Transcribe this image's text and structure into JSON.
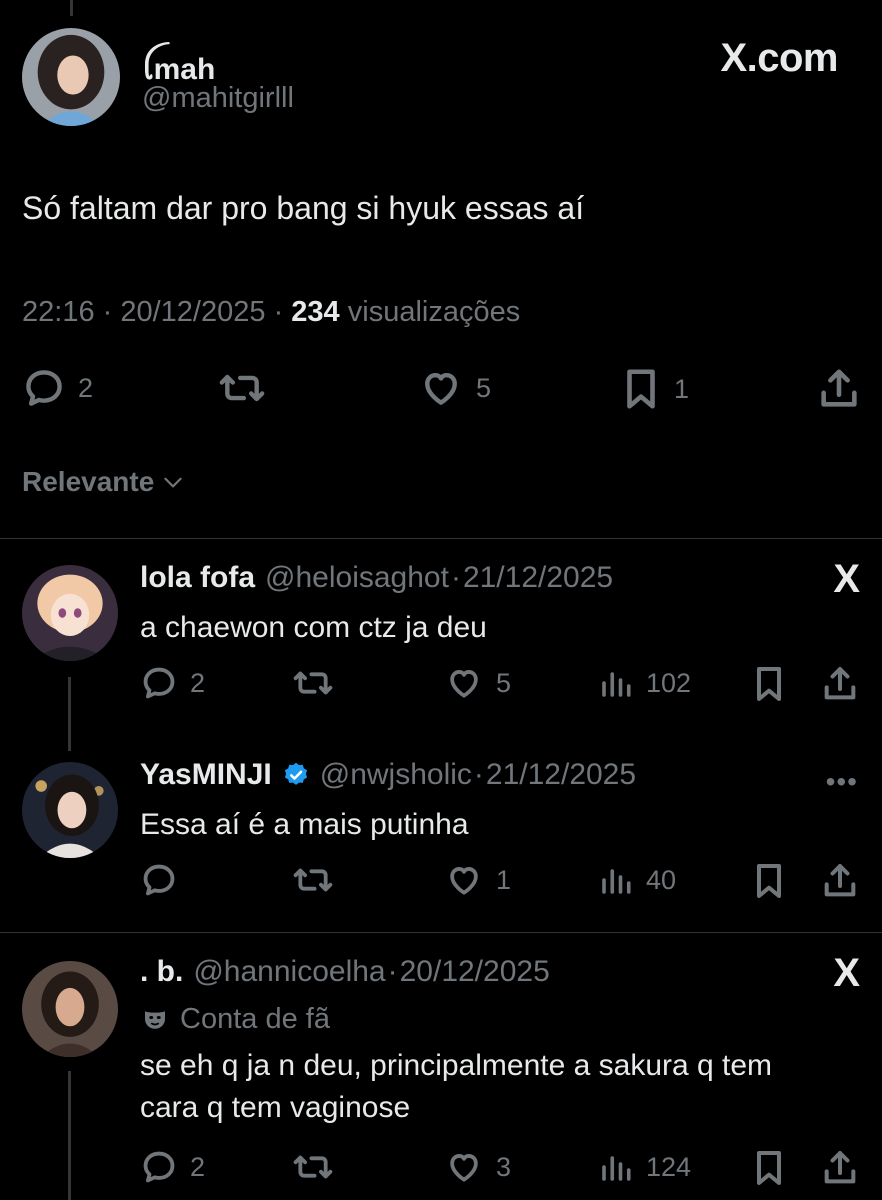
{
  "main_tweet": {
    "display_name": "ꪶmah",
    "handle": "@mahitgirlll",
    "brand": "X.com",
    "text": "Só faltam dar pro bang si hyuk essas aí",
    "time": "22:16",
    "date": "20/12/2025",
    "views_count": "234",
    "views_label": "visualizações",
    "replies": "2",
    "likes": "5",
    "bookmarks": "1"
  },
  "sort_label": "Relevante",
  "replies": [
    {
      "name": "lola fofa",
      "handle": "@heloisaghot",
      "date": "21/12/2025",
      "text": "a chaewon com ctz ja deu",
      "replies": "2",
      "likes": "5",
      "views": "102",
      "corner": "X"
    },
    {
      "name": "YasMINJI",
      "handle": "@nwjsholic",
      "date": "21/12/2025",
      "text": "Essa aí é a mais putinha",
      "replies": "",
      "likes": "1",
      "views": "40",
      "corner": "•••"
    },
    {
      "name": ". b.",
      "handle": "@hannicoelha",
      "date": "20/12/2025",
      "badge": "Conta de fã",
      "text_line1": "se eh q ja n deu, principalmente a sakura q tem",
      "text_line2": "cara q tem vaginose",
      "replies": "2",
      "likes": "3",
      "views": "124",
      "corner": "X"
    }
  ],
  "colors": {
    "background": "#000000",
    "text_primary": "#e7e9ea",
    "text_secondary": "#71767b",
    "divider": "#2f3336",
    "verified": "#1d9bf0"
  }
}
